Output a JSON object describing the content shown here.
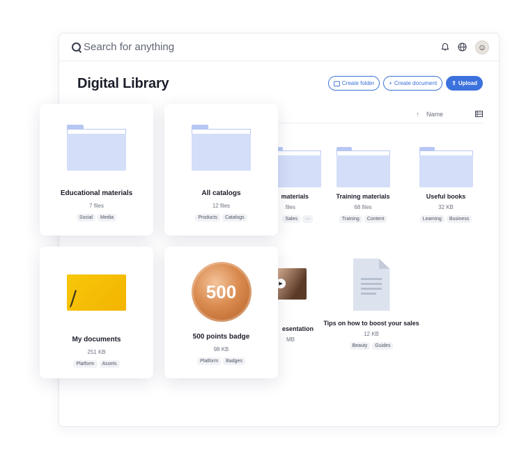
{
  "topbar": {
    "search_placeholder": "Search for anything",
    "avatar_glyph": "☺"
  },
  "page": {
    "title": "Digital Library"
  },
  "actions": {
    "create_folder": "Create folder",
    "create_document": "Create document",
    "upload": "Upload"
  },
  "sort": {
    "label": "Name",
    "arrow": "↑"
  },
  "background_items": [
    {
      "name": "materials",
      "meta": "files",
      "tags": [
        "Sales",
        "···"
      ]
    },
    {
      "name": "Training materials",
      "meta": "68 files",
      "tags": [
        "Training",
        "Content"
      ]
    },
    {
      "name": "Useful books",
      "meta": "32 KB",
      "tags": [
        "Learning",
        "Business"
      ]
    },
    {
      "name": "esentation",
      "meta": "MB",
      "tags": []
    },
    {
      "name": "Tips on how to boost your sales",
      "meta": "12 KB",
      "tags": [
        "Beauty",
        "Guides"
      ]
    }
  ],
  "front_cards": [
    {
      "name": "Educational materials",
      "meta": "7 files",
      "tags": [
        "Social",
        "Media"
      ]
    },
    {
      "name": "All catalogs",
      "meta": "12 files",
      "tags": [
        "Products",
        "Catalogs"
      ]
    },
    {
      "name": "My documents",
      "meta": "251 KB",
      "tags": [
        "Platform",
        "Assets"
      ]
    },
    {
      "name": "500 points badge",
      "meta": "98 KB",
      "tags": [
        "Platform",
        "Badges"
      ],
      "badge_text": "500"
    }
  ],
  "colors": {
    "accent": "#3c72de",
    "folder": "#d4def9",
    "badge": "#d98a4e",
    "doc_yellow": "#f7c70a"
  }
}
